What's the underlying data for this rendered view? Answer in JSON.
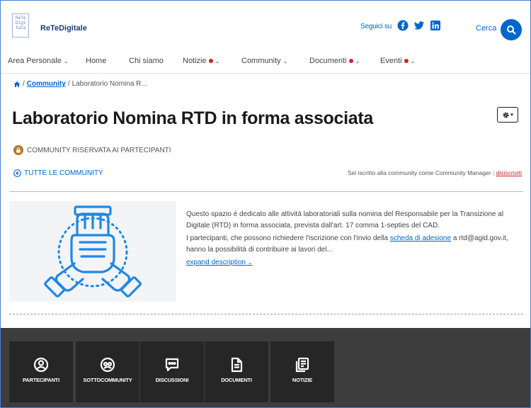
{
  "header": {
    "logo_text": "ReTe\nDigi\ntale",
    "brand": "ReTeDigitale",
    "follow_label": "Seguici su",
    "social": [
      "facebook-icon",
      "twitter-icon",
      "linkedin-icon"
    ],
    "search_label": "Cerca"
  },
  "nav": {
    "items": [
      {
        "label": "Area Personale",
        "dropdown": true,
        "dot": false
      },
      {
        "label": "Home",
        "dropdown": false,
        "dot": false
      },
      {
        "label": "Chi siamo",
        "dropdown": false,
        "dot": false
      },
      {
        "label": "Notizie",
        "dropdown": true,
        "dot": true
      },
      {
        "label": "Community",
        "dropdown": true,
        "dot": false
      },
      {
        "label": "Documenti",
        "dropdown": true,
        "dot": true
      },
      {
        "label": "Eventi",
        "dropdown": true,
        "dot": true
      }
    ]
  },
  "breadcrumb": {
    "separator": "/",
    "link": "Community",
    "current": "Laboratorio Nomina R..."
  },
  "page": {
    "title": "Laboratorio Nomina RTD in forma associata",
    "restricted_label": "COMMUNITY RISERVATA AI PARTECIPANTI",
    "all_communities": "TUTTE LE COMMUNITY",
    "enrolled_text": "Sei iscritto alla community come Community Manager",
    "enrolled_sep": "|",
    "unsubscribe": "disiscriviti"
  },
  "description": {
    "p1": "Questo spazio è dedicato alle attività laboratoriali sulla nomina del Responsabile per la Transizione al Digitale (RTD) in forma associata, prevista dall'art. 17 comma 1-septies del CAD.",
    "p2_before": "I partecipanti, che possono richiedere l'iscrizione con l'invio della ",
    "p2_link": "scheda di adesione",
    "p2_after": " a rtd@agid.gov.it, hanno la possibilità di contribuire ai lavori del...",
    "expand": "expand description"
  },
  "tiles": [
    {
      "label": "PARTECIPANTI",
      "icon": "user-circle-icon"
    },
    {
      "label": "SOTTOCOMMUNITY",
      "icon": "subcommunity-icon"
    },
    {
      "label": "DISCUSSIONI",
      "icon": "chat-icon"
    },
    {
      "label": "DOCUMENTI",
      "icon": "document-icon"
    },
    {
      "label": "NOTIZIE",
      "icon": "news-icon"
    }
  ],
  "colors": {
    "primary": "#0066cc",
    "accent_red": "#d1222d",
    "lock_brown": "#b5762a",
    "dark_band": "#3d3d3d",
    "tile_bg": "#262626"
  }
}
